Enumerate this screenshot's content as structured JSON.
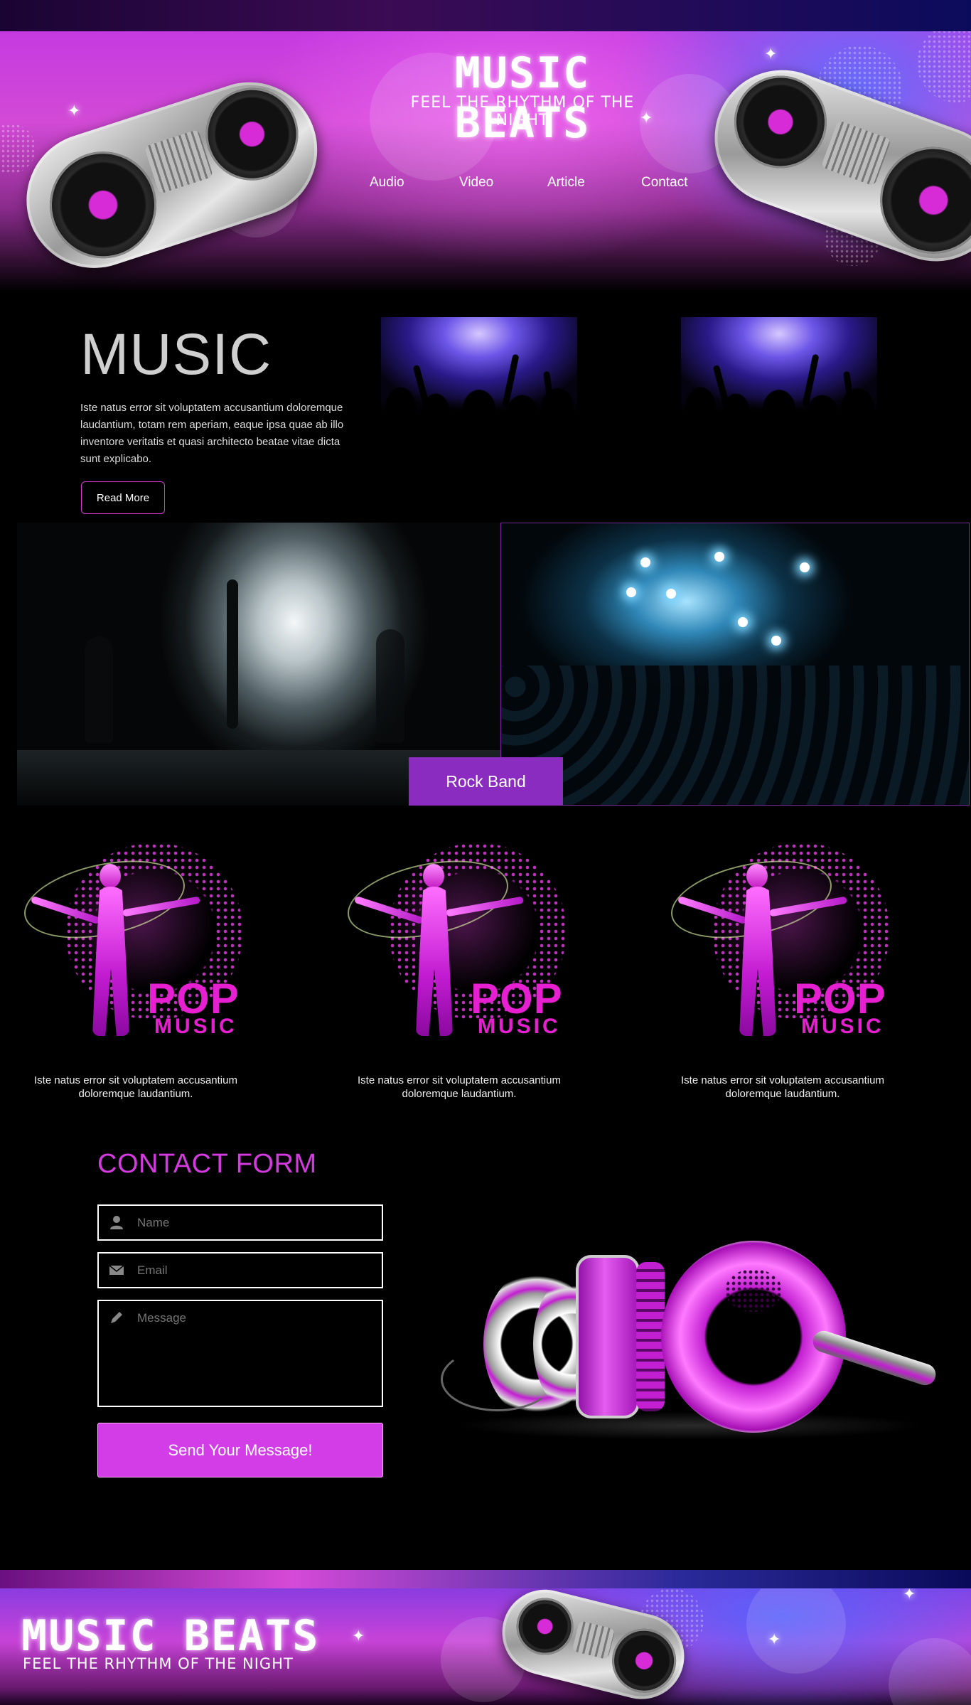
{
  "brand": {
    "title": "MUSIC BEATS",
    "tagline": "FEEL THE RHYTHM OF THE NIGHT"
  },
  "nav": {
    "items": [
      {
        "label": "Audio"
      },
      {
        "label": "Video"
      },
      {
        "label": "Article"
      },
      {
        "label": "Contact"
      }
    ]
  },
  "intro": {
    "heading": "MUSIC",
    "text": "Iste natus error sit voluptatem accusantium doloremque laudantium, totam rem aperiam, eaque ipsa quae ab illo inventore veritatis et quasi architecto beatae vitae dicta sunt explicabo.",
    "button": "Read More"
  },
  "band": {
    "button": "Rock Band"
  },
  "pop_cards": [
    {
      "pop": "POP",
      "music": "MUSIC",
      "caption": "Iste natus error sit voluptatem accusantium doloremque laudantium."
    },
    {
      "pop": "POP",
      "music": "MUSIC",
      "caption": "Iste natus error sit voluptatem accusantium doloremque laudantium."
    },
    {
      "pop": "POP",
      "music": "MUSIC",
      "caption": "Iste natus error sit voluptatem accusantium doloremque laudantium."
    }
  ],
  "contact": {
    "heading": "CONTACT FORM",
    "name_placeholder": "Name",
    "email_placeholder": "Email",
    "message_placeholder": "Message",
    "submit": "Send Your Message!"
  },
  "footer": {
    "title": "MUSIC BEATS",
    "tagline": "FEEL THE RHYTHM OF THE NIGHT"
  },
  "colors": {
    "accent": "#d23de8",
    "button_purple": "#8a2cbf",
    "heading_magenta": "#d53ae0"
  },
  "icons": [
    "user-icon",
    "envelope-icon",
    "pencil-icon",
    "turntable-icon",
    "sparkle-icon"
  ]
}
